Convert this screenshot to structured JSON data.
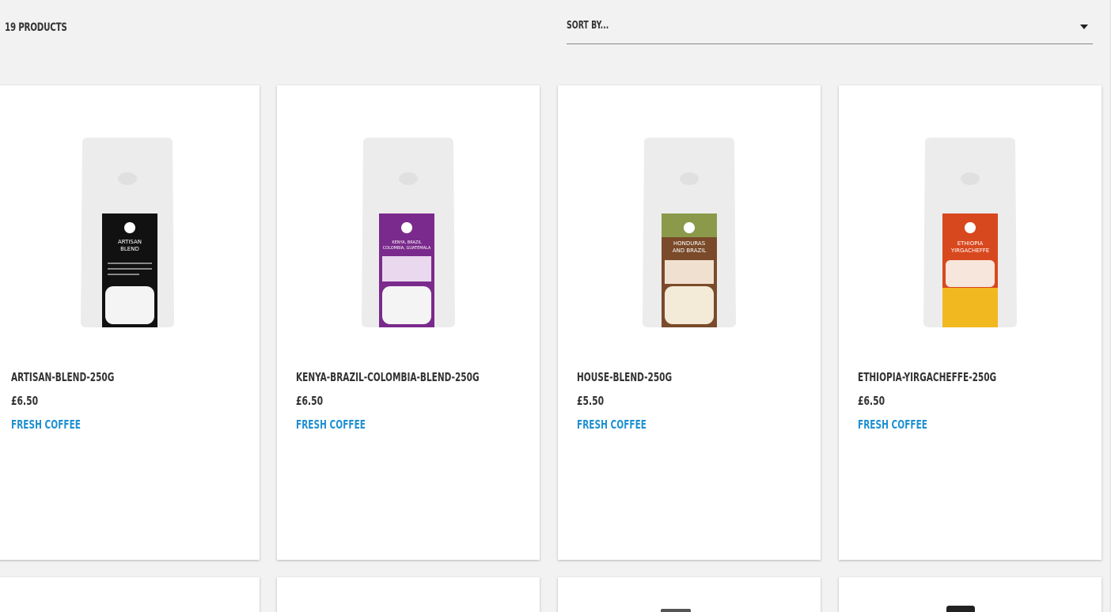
{
  "header": {
    "product_count": "19 PRODUCTS",
    "sort_label": "SORT BY..."
  },
  "products": [
    {
      "name": "ARTISAN-BLEND-250G",
      "price": "£6.50",
      "category": "FRESH COFFEE",
      "label_color": "#111111",
      "label_text_1": "ARTISAN",
      "label_text_2": "BLEND"
    },
    {
      "name": "KENYA-BRAZIL-COLOMBIA-BLEND-250G",
      "price": "£6.50",
      "category": "FRESH COFFEE",
      "label_color": "#7a2a8c",
      "label_text_1": "KENYA, BRAZIL",
      "label_text_2": "COLOMBIA, GUATEMALA"
    },
    {
      "name": "HOUSE-BLEND-250G",
      "price": "£5.50",
      "category": "FRESH COFFEE",
      "label_color": "#7a4a2a",
      "label_text_1": "HONDURAS",
      "label_text_2": "AND BRAZIL"
    },
    {
      "name": "ETHIOPIA-YIRGACHEFFE-250G",
      "price": "£6.50",
      "category": "FRESH COFFEE",
      "label_color": "#d8481e",
      "label_text_1": "ETHIOPIA",
      "label_text_2": "YIRGACHEFFE"
    }
  ],
  "colors": {
    "accent": "#1e90d2",
    "text": "#333333",
    "bag": "#ebebeb"
  }
}
